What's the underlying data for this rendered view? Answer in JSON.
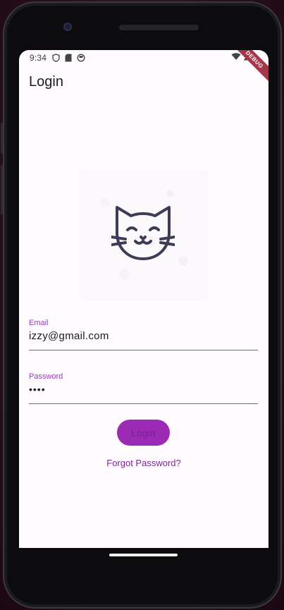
{
  "status_bar": {
    "time": "9:34",
    "icons": [
      "shield-icon",
      "sd-card-icon",
      "sync-icon"
    ],
    "right_icons": [
      "wifi-icon",
      "signal-icon"
    ]
  },
  "debug_banner": "DEBUG",
  "app_bar": {
    "title": "Login"
  },
  "hero": {
    "icon": "cat-face-icon"
  },
  "form": {
    "email": {
      "label": "Email",
      "value": "izzy@gmail.com"
    },
    "password": {
      "label": "Password",
      "value": "••••"
    }
  },
  "actions": {
    "login_label": "Login",
    "forgot_label": "Forgot Password?"
  },
  "colors": {
    "accent": "#9b2ab5",
    "label": "#9a3ab8",
    "background": "#fffbff",
    "icon": "#403b54"
  }
}
